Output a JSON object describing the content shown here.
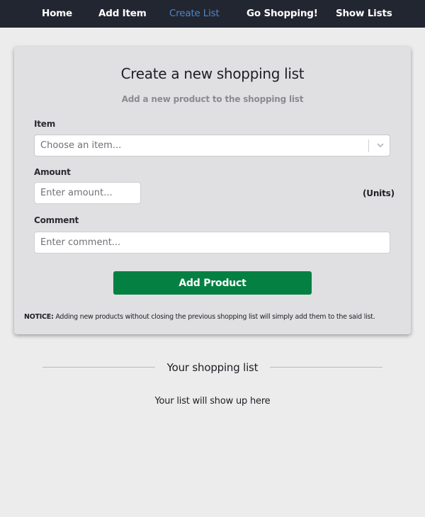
{
  "nav": {
    "items": [
      {
        "label": "Home",
        "active": false
      },
      {
        "label": "Add Item",
        "active": false
      },
      {
        "label": "Create List",
        "active": true
      },
      {
        "label": "Go Shopping!",
        "active": false
      },
      {
        "label": "Show Lists",
        "active": false
      }
    ]
  },
  "form": {
    "title": "Create a new shopping list",
    "subtitle": "Add a new product to the shopping list",
    "item_label": "Item",
    "item_placeholder": "Choose an item...",
    "amount_label": "Amount",
    "amount_placeholder": "Enter amount...",
    "units_label": "(Units)",
    "comment_label": "Comment",
    "comment_placeholder": "Enter comment...",
    "submit_label": "Add Product",
    "notice_prefix": "NOTICE:",
    "notice_text": " Adding new products without closing the previous shopping list will simply add them to the said list."
  },
  "shopping_list": {
    "heading": "Your shopping list",
    "empty_text": "Your list will show up here"
  },
  "colors": {
    "navbar": "#222631",
    "active_link": "#4d86c9",
    "primary_button": "#048142",
    "page_background": "#ececed",
    "card_background": "#e0e0e2"
  }
}
